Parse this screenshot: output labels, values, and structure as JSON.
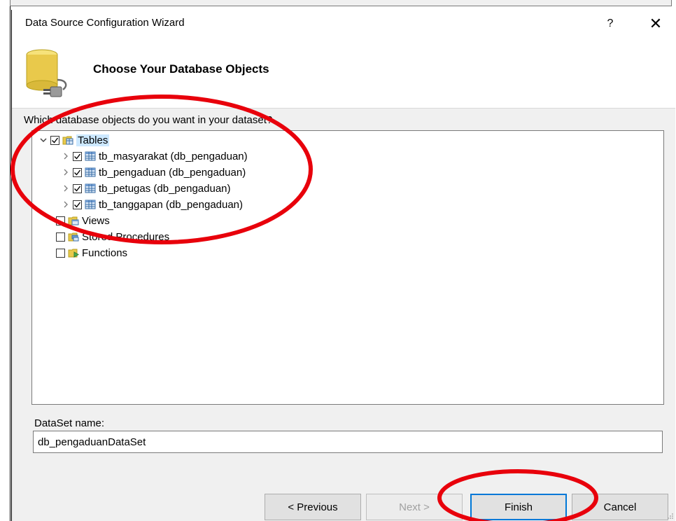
{
  "dialog": {
    "title": "Data Source Configuration Wizard",
    "help_label": "?",
    "close_label": "✕",
    "header_title": "Choose Your Database Objects"
  },
  "content": {
    "question": "Which database objects do you want in your dataset?",
    "tree": [
      {
        "label": "Tables",
        "checked": true,
        "expanded": true,
        "selected": true,
        "icon": "tables-folder-icon"
      },
      {
        "label": "tb_masyarakat (db_pengaduan)",
        "checked": true,
        "icon": "table-grid-icon"
      },
      {
        "label": "tb_pengaduan (db_pengaduan)",
        "checked": true,
        "icon": "table-grid-icon"
      },
      {
        "label": "tb_petugas (db_pengaduan)",
        "checked": true,
        "icon": "table-grid-icon"
      },
      {
        "label": "tb_tanggapan (db_pengaduan)",
        "checked": true,
        "icon": "table-grid-icon"
      },
      {
        "label": "Views",
        "checked": false,
        "icon": "views-folder-icon"
      },
      {
        "label": "Stored Procedures",
        "checked": false,
        "icon": "procedures-folder-icon"
      },
      {
        "label": "Functions",
        "checked": false,
        "icon": "functions-folder-icon"
      }
    ],
    "dataset_label": "DataSet name:",
    "dataset_value": "db_pengaduanDataSet"
  },
  "buttons": {
    "previous": "< Previous",
    "next": "Next >",
    "finish": "Finish",
    "cancel": "Cancel"
  },
  "colors": {
    "annotation": "#e8000b",
    "selection": "#cce8ff",
    "default_button_border": "#0078d7"
  }
}
